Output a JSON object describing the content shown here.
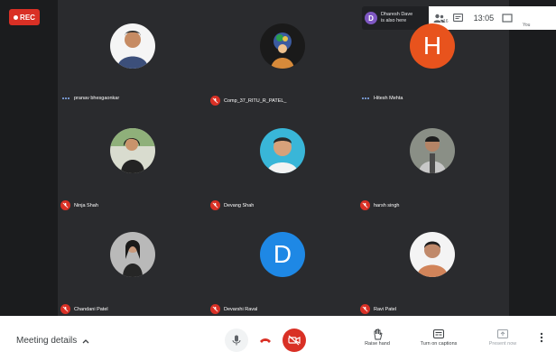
{
  "recording": {
    "label": "REC"
  },
  "notification": {
    "avatar_letter": "D",
    "line1": "Dharesh Dave",
    "line2": "is also here"
  },
  "status": {
    "time": "13:05",
    "you_label": "You",
    "people_count": "16"
  },
  "participants": [
    {
      "name": "pranav bhesgaonkar",
      "mic": "active",
      "avatar": "photo"
    },
    {
      "name": "Comp_37_RITU_R_PATEL_",
      "mic": "muted",
      "avatar": "photo"
    },
    {
      "name": "Hitesh Mehta",
      "mic": "active",
      "avatar": "letter",
      "letter": "H",
      "color": "#e8531d"
    },
    {
      "name": "Ninja Shah",
      "mic": "muted",
      "avatar": "photo"
    },
    {
      "name": "Devang Shah",
      "mic": "muted",
      "avatar": "photo"
    },
    {
      "name": "harsh singh",
      "mic": "muted",
      "avatar": "photo"
    },
    {
      "name": "Chandani Patel",
      "mic": "muted",
      "avatar": "photo"
    },
    {
      "name": "Devarshi Raval",
      "mic": "muted",
      "avatar": "letter",
      "letter": "D",
      "color": "#1e88e5"
    },
    {
      "name": "Ravi Patel",
      "mic": "muted",
      "avatar": "photo"
    }
  ],
  "bottom": {
    "meeting_details": "Meeting details",
    "raise_hand": "Raise hand",
    "captions": "Turn on captions",
    "present": "Present now"
  },
  "colors": {
    "accent_red": "#d93025",
    "bg": "#202124"
  }
}
